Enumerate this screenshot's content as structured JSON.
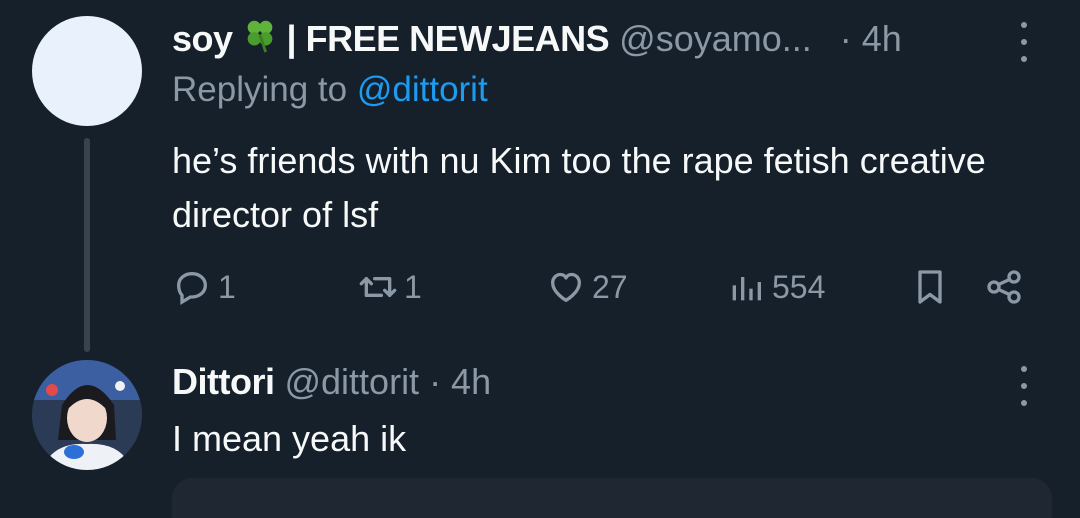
{
  "tweet": {
    "display_name": "soy",
    "emoji": "☘️",
    "name_suffix": "| FREE NEWJEANS",
    "handle": "@soyamo...",
    "time": "· 4h",
    "replying_prefix": "Replying to",
    "replying_to": "@dittorit",
    "text": "he’s friends with nu Kim too the rape fetish creative director of lsf",
    "replies": "1",
    "retweets": "1",
    "likes": "27",
    "views": "554"
  },
  "reply": {
    "display_name": "Dittori",
    "handle": "@dittorit",
    "time": "· 4h",
    "text": "I mean yeah ik"
  },
  "colors": {
    "background": "#15202b",
    "muted": "#8b98a5",
    "accent": "#1d9bf0",
    "text": "#f7f9f9"
  },
  "icons": {
    "reply": "reply-icon",
    "retweet": "retweet-icon",
    "like": "heart-icon",
    "views": "analytics-icon",
    "bookmark": "bookmark-icon",
    "share": "share-icon",
    "more": "more-icon"
  }
}
